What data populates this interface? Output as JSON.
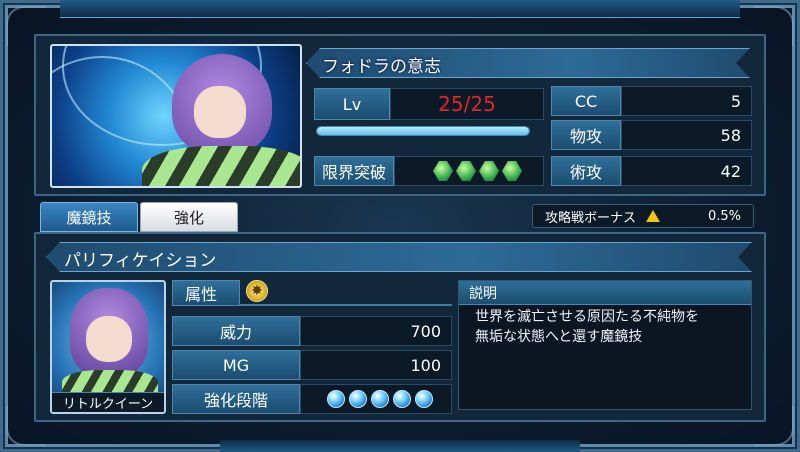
{
  "card": {
    "title": "フォドラの意志",
    "lv_label": "Lv",
    "lv_value": "25/25",
    "exp_progress": 1.0,
    "limit_label": "限界突破",
    "limit_gems": 4,
    "stats": {
      "cc_label": "CC",
      "cc_value": "5",
      "atk_label": "物攻",
      "atk_value": "58",
      "matk_label": "術攻",
      "matk_value": "42"
    }
  },
  "tabs": {
    "active": "魔鏡技",
    "inactive": "強化"
  },
  "bonus": {
    "label": "攻略戦ボーナス",
    "value": "0.5%",
    "icon": "up-arrow-icon"
  },
  "skill": {
    "name": "パリフィケイション",
    "portrait_caption": "リトルクイーン",
    "attr_label": "属性",
    "attr_icon": "light-element-icon",
    "power_label": "威力",
    "power_value": "700",
    "mg_label": "MG",
    "mg_value": "100",
    "stage_label": "強化段階",
    "stage_orbs": 5,
    "desc_label": "説明",
    "desc_line1": "世界を滅亡させる原因たる不純物を",
    "desc_line2": "無垢な状態へと還す魔鏡技"
  },
  "colors": {
    "accent_blue": "#2d6b96",
    "level_red": "#e0262a",
    "bonus_yellow": "#f3c31d"
  }
}
